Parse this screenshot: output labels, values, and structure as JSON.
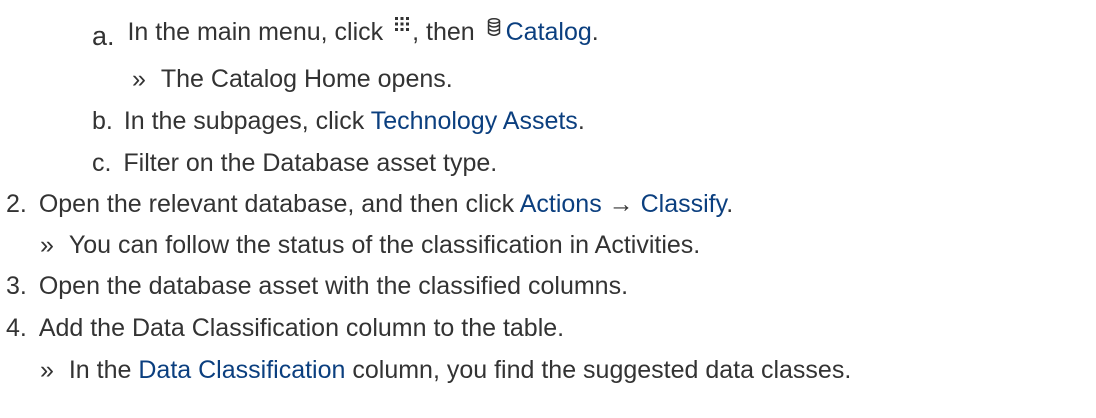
{
  "steps": {
    "a": {
      "marker": "a.",
      "text_1": "In the main menu, click",
      "icon_1": "grid-menu-icon",
      "text_2": ", then",
      "icon_2": "database-icon",
      "ui_1": "Catalog",
      "text_3": "."
    },
    "a_result": {
      "marker": "»",
      "text": "The Catalog Home opens."
    },
    "b": {
      "marker": "b.",
      "text_1": "In the subpages, click",
      "ui_1": "Technology Assets",
      "text_2": "."
    },
    "c": {
      "marker": "c.",
      "text": "Filter on the Database asset type."
    },
    "s2": {
      "marker": "2.",
      "text_1": "Open the relevant database, and then click",
      "ui_1": "Actions",
      "arrow": "→",
      "ui_2": "Classify",
      "text_2": "."
    },
    "s2_result": {
      "marker": "»",
      "text": "You can follow the status of the classification in Activities."
    },
    "s3": {
      "marker": "3.",
      "text": "Open the database asset with the classified columns."
    },
    "s4": {
      "marker": "4.",
      "text": "Add the Data Classification column to the table."
    },
    "s4_result": {
      "marker": "»",
      "text_1": "In the",
      "ui_1": "Data Classification",
      "text_2": "column, you find the suggested data classes."
    }
  },
  "colors": {
    "text": "#333333",
    "ui_term": "#0b3f7f"
  }
}
